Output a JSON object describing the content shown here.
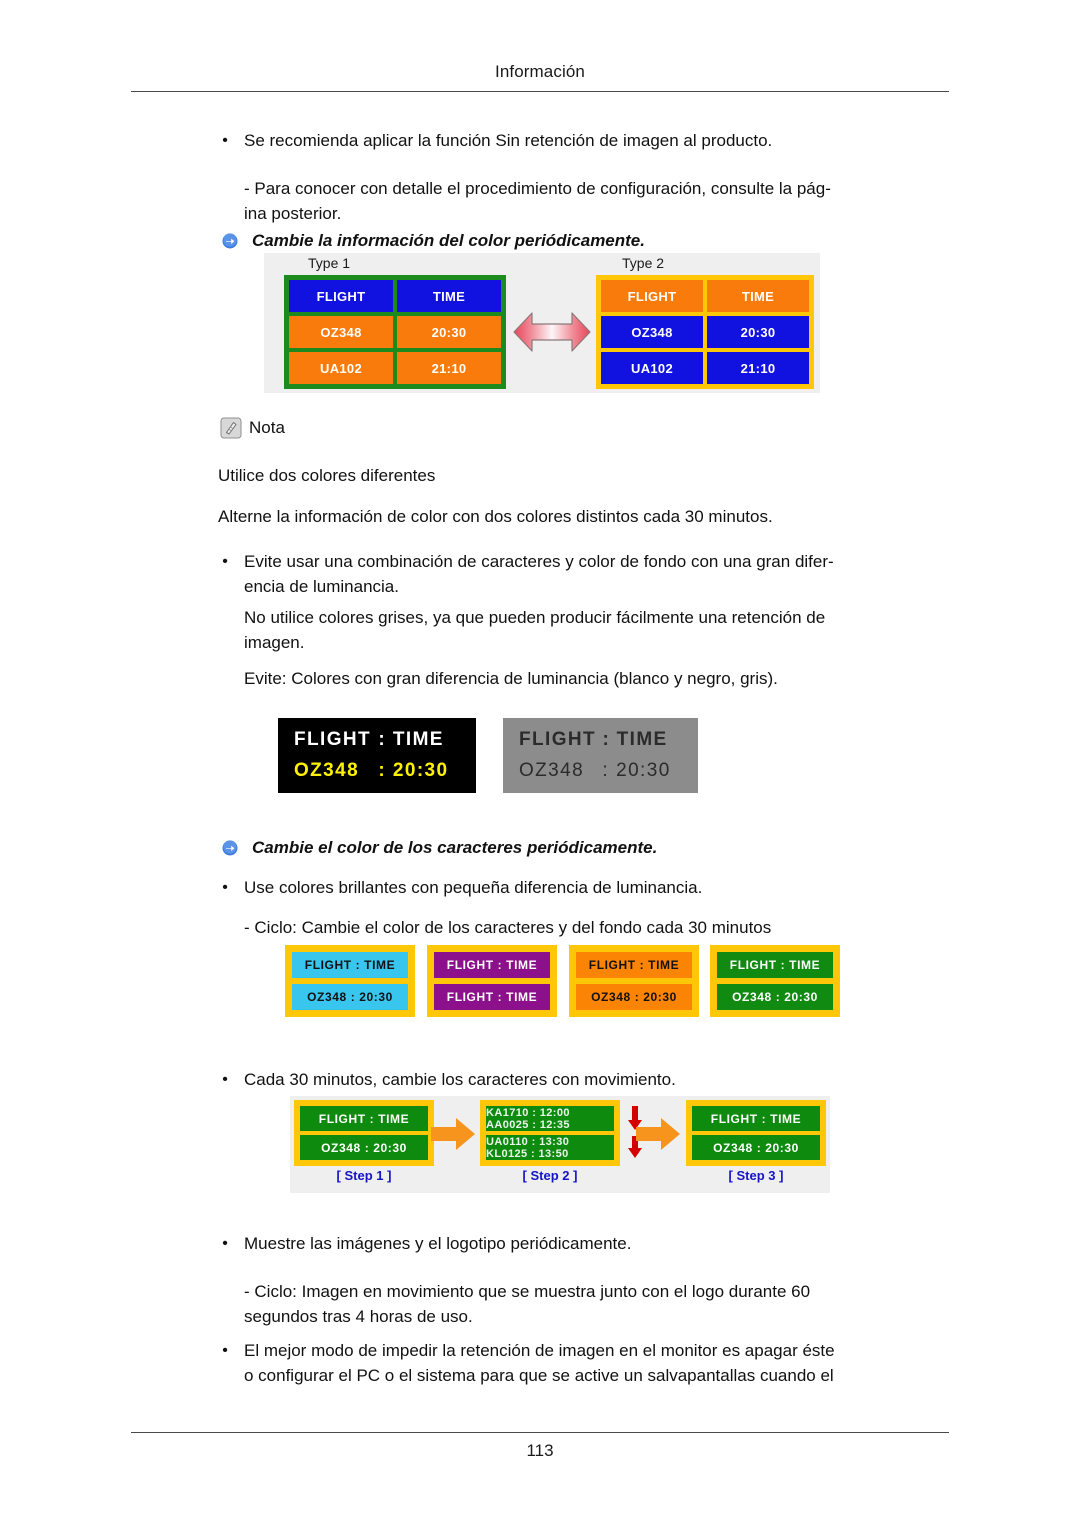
{
  "header": {
    "title": "Información"
  },
  "footer": {
    "page_number": "113"
  },
  "body": {
    "bullet_glyph": "•",
    "b1": "Se recomienda aplicar la función Sin retención de imagen al producto.",
    "b1_sub_l1": "- Para conocer con detalle el procedimiento de configuración, consulte la pág-",
    "b1_sub_l2": "ina posterior.",
    "heading1": "Cambie la información del color periódicamente.",
    "nota_label": "Nota",
    "nota_line1": "Utilice dos colores diferentes",
    "nota_line2": "Alterne la información de color con dos colores distintos cada 30 minutos.",
    "b2_l1": "Evite usar una combinación de caracteres y color de fondo con una gran difer-",
    "b2_l2": "encia de luminancia.",
    "b2_sub1_l1": "No utilice colores grises, ya que pueden producir fácilmente una retención de",
    "b2_sub1_l2": "imagen.",
    "b2_sub2": "Evite: Colores con gran diferencia de luminancia (blanco y negro, gris).",
    "heading2": "Cambie el color de los caracteres periódicamente.",
    "b3": "Use colores brillantes con pequeña diferencia de luminancia.",
    "b3_sub": "- Ciclo: Cambie el color de los caracteres y del fondo cada 30 minutos",
    "b4": "Cada 30 minutos, cambie los caracteres con movimiento.",
    "b5": "Muestre las imágenes y el logotipo periódicamente.",
    "b5_sub_l1": "- Ciclo: Imagen en movimiento que se muestra junto con el logo durante 60",
    "b5_sub_l2": "segundos tras 4 horas de uso.",
    "b6_l1": "El mejor modo de impedir la retención de imagen en el monitor es apagar éste",
    "b6_l2": "o configurar el PC o el sistema para que se active un salvapantallas cuando el"
  },
  "figure_color_info": {
    "type1_label": "Type 1",
    "type2_label": "Type 2",
    "headers": [
      "FLIGHT",
      "TIME"
    ],
    "rows": [
      [
        "OZ348",
        "20:30"
      ],
      [
        "UA102",
        "21:10"
      ]
    ],
    "type1_colors": {
      "frame": "#1c8a1c",
      "header_bg": "#1212e0",
      "header_fg": "#ffffff",
      "data_bg": "#f97b0b",
      "data_fg": "#ffffff"
    },
    "type2_colors": {
      "frame": "#ffc708",
      "header_bg": "#f97b0b",
      "header_fg": "#ffffff",
      "data_bg": "#1212e0",
      "data_fg": "#ffffff"
    },
    "arrow_color": "#e8455a"
  },
  "figure_luminance": {
    "panels": [
      {
        "name": "black-panel",
        "bg": "#000000",
        "row1": {
          "a": "FLIGHT",
          "sep": ":",
          "b": "TIME",
          "color": "#ffffff"
        },
        "row2": {
          "a": "OZ348",
          "sep": ":",
          "b": "20:30",
          "color": "#fff200"
        }
      },
      {
        "name": "gray-panel",
        "bg": "#8c8c8c",
        "row1": {
          "a": "FLIGHT",
          "sep": ":",
          "b": "TIME",
          "color": "#2b2b2b"
        },
        "row2": {
          "a": "OZ348",
          "sep": ":",
          "b": "20:30",
          "color": "#2b2b2b"
        }
      }
    ]
  },
  "figure_color_cycle": {
    "frame_color": "#ffc708",
    "panels": [
      {
        "name": "cyan-panel",
        "bg": "#39c6ee",
        "fg": "#111111",
        "row1": "FLIGHT : TIME",
        "row2": "OZ348   : 20:30"
      },
      {
        "name": "purple-panel",
        "bg": "#8c0f8c",
        "fg": "#ffffff",
        "row1": "FLIGHT : TIME",
        "row2": "FLIGHT : TIME"
      },
      {
        "name": "orange-panel",
        "bg": "#fb8404",
        "fg": "#111111",
        "row1": "FLIGHT : TIME",
        "row2": "OZ348   : 20:30"
      },
      {
        "name": "green-panel",
        "bg": "#118a11",
        "fg": "#ffffff",
        "row1": "FLIGHT : TIME",
        "row2": "OZ348   : 20:30"
      }
    ]
  },
  "figure_steps": {
    "frame_color": "#ffc708",
    "screen_color": "#0e8a0e",
    "arrow_color": "#f7941e",
    "down_arrow_color": "#d40000",
    "steps": [
      {
        "caption": "[ Step 1 ]",
        "row1": "FLIGHT : TIME",
        "row2": "OZ348   : 20:30",
        "blurred": false
      },
      {
        "caption": "[ Step 2 ]",
        "row1": "KA1710 : 12:00",
        "row1b": "AA0025 : 12:35",
        "row2": "UA0110 : 13:30",
        "row2b": "KL0125 : 13:50",
        "blurred": true
      },
      {
        "caption": "[ Step 3 ]",
        "row1": "FLIGHT : TIME",
        "row2": "OZ348   : 20:30",
        "blurred": false
      }
    ]
  }
}
